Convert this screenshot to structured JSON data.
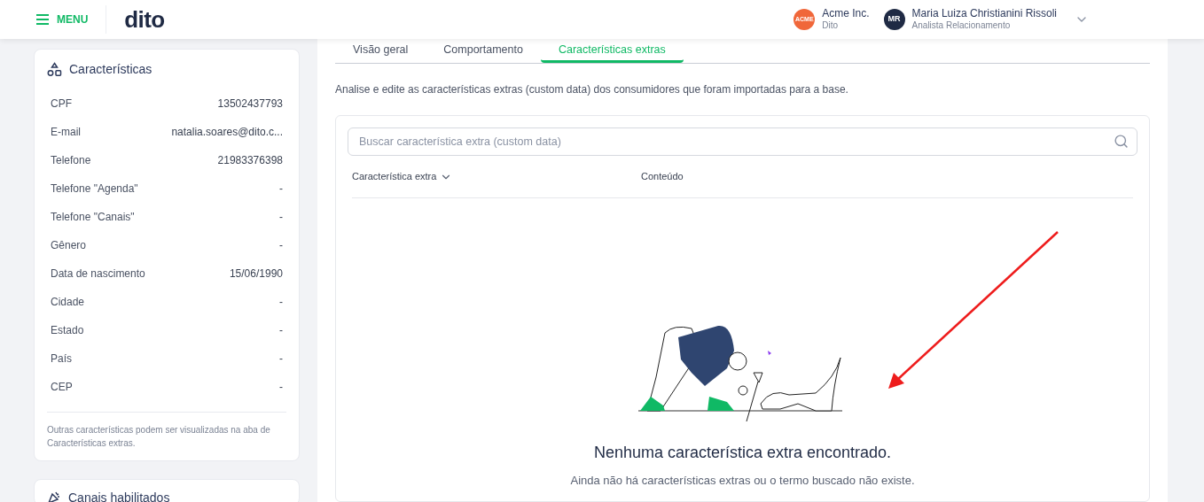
{
  "header": {
    "menu_label": "MENU",
    "logo": "dito",
    "company": {
      "avatar": "ACME",
      "name": "Acme Inc.",
      "subtitle": "Dito"
    },
    "user": {
      "avatar": "MR",
      "name": "Maria Luiza Christianini Rissoli",
      "role": "Analista Relacionamento"
    }
  },
  "attributes_card": {
    "title": "Características",
    "rows": [
      {
        "label": "CPF",
        "value": "13502437793"
      },
      {
        "label": "E-mail",
        "value": "natalia.soares@dito.c..."
      },
      {
        "label": "Telefone",
        "value": "21983376398"
      },
      {
        "label": "Telefone \"Agenda\"",
        "value": "-"
      },
      {
        "label": "Telefone \"Canais\"",
        "value": "-"
      },
      {
        "label": "Gênero",
        "value": "-"
      },
      {
        "label": "Data de nascimento",
        "value": "15/06/1990"
      },
      {
        "label": "Cidade",
        "value": "-"
      },
      {
        "label": "Estado",
        "value": "-"
      },
      {
        "label": "País",
        "value": "-"
      },
      {
        "label": "CEP",
        "value": "-"
      }
    ],
    "note": "Outras características podem ser visualizadas na aba de Características extras."
  },
  "channels_card": {
    "title": "Canais habilitados"
  },
  "tabs": [
    {
      "label": "Visão geral",
      "selected": false
    },
    {
      "label": "Comportamento",
      "selected": false
    },
    {
      "label": "Características extras",
      "selected": true
    }
  ],
  "description": "Analise e edite as características extras (custom data) dos consumidores que foram importadas para a base.",
  "search": {
    "placeholder": "Buscar característica extra (custom data)"
  },
  "table": {
    "columns": [
      {
        "label": "Característica extra",
        "sortable": true
      },
      {
        "label": "Conteúdo",
        "sortable": false
      }
    ]
  },
  "empty_state": {
    "title": "Nenhuma característica extra encontrado.",
    "message": "Ainda não há características extras ou o termo buscado não existe."
  }
}
